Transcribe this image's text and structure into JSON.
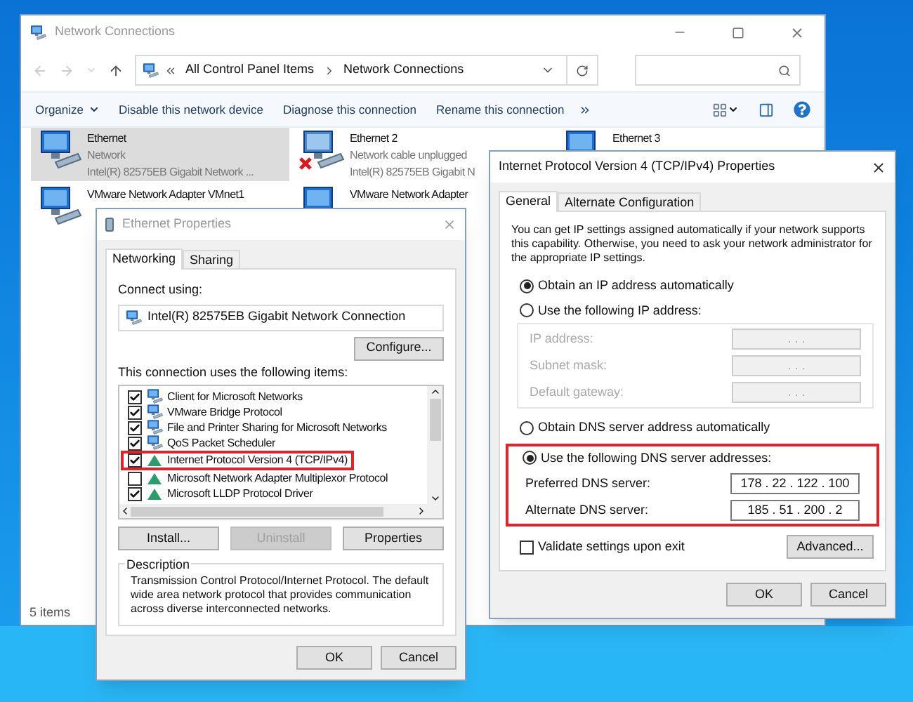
{
  "window": {
    "title": "Network Connections",
    "breadcrumb": [
      "All Control Panel Items",
      "Network Connections"
    ]
  },
  "toolbar": [
    {
      "label": "Organize",
      "dropdown": true
    },
    {
      "label": "Disable this network device",
      "dropdown": false
    },
    {
      "label": "Diagnose this connection",
      "dropdown": false
    },
    {
      "label": "Rename this connection",
      "dropdown": false
    }
  ],
  "connections": [
    {
      "name": "Ethernet",
      "status": "Network",
      "adapter": "Intel(R) 82575EB Gigabit Network ...",
      "selected": true,
      "disconnected": false
    },
    {
      "name": "Ethernet 2",
      "status": "Network cable unplugged",
      "adapter": "Intel(R) 82575EB Gigabit N",
      "selected": false,
      "disconnected": true
    },
    {
      "name": "Ethernet 3",
      "selected": false,
      "disconnected": false
    },
    {
      "name": "VMware Network Adapter VMnet1",
      "selected": false,
      "disconnected": false
    },
    {
      "name": "VMware Network Adapter",
      "selected": false,
      "disconnected": false
    }
  ],
  "status_bar": "5 items",
  "ethernet_properties": {
    "title": "Ethernet Properties",
    "tabs": [
      {
        "label": "Networking",
        "selected": true
      },
      {
        "label": "Sharing",
        "selected": false
      }
    ],
    "connect_using_label": "Connect using:",
    "adapter": "Intel(R) 82575EB Gigabit Network Connection",
    "configure_button": "Configure...",
    "items_label": "This connection uses the following items:",
    "items": [
      {
        "label": "Client for Microsoft Networks",
        "kind": "service",
        "checked": true,
        "highlighted": false
      },
      {
        "label": "VMware Bridge Protocol",
        "kind": "service",
        "checked": true,
        "highlighted": false
      },
      {
        "label": "File and Printer Sharing for Microsoft Networks",
        "kind": "service",
        "checked": true,
        "highlighted": false
      },
      {
        "label": "QoS Packet Scheduler",
        "kind": "service",
        "checked": true,
        "highlighted": false
      },
      {
        "label": "Internet Protocol Version 4 (TCP/IPv4)",
        "kind": "protocol",
        "checked": true,
        "highlighted": true
      },
      {
        "label": "Microsoft Network Adapter Multiplexor Protocol",
        "kind": "protocol",
        "checked": false,
        "highlighted": false
      },
      {
        "label": "Microsoft LLDP Protocol Driver",
        "kind": "protocol",
        "checked": true,
        "highlighted": false
      }
    ],
    "buttons": [
      {
        "label": "Install...",
        "disabled": false
      },
      {
        "label": "Uninstall",
        "disabled": true
      },
      {
        "label": "Properties",
        "disabled": false
      }
    ],
    "description_label": "Description",
    "description": "Transmission Control Protocol/Internet Protocol. The default wide area network protocol that provides communication across diverse interconnected networks.",
    "dialog_buttons": [
      "OK",
      "Cancel"
    ]
  },
  "ipv4_properties": {
    "title": "Internet Protocol Version 4 (TCP/IPv4) Properties",
    "tabs": [
      {
        "label": "General",
        "selected": true
      },
      {
        "label": "Alternate Configuration",
        "selected": false
      }
    ],
    "intro": "You can get IP settings assigned automatically if your network supports this capability. Otherwise, you need to ask your network administrator for the appropriate IP settings.",
    "ip_options": [
      {
        "label": "Obtain an IP address automatically",
        "selected": true
      },
      {
        "label": "Use the following IP address:",
        "selected": false
      }
    ],
    "ip_fields": [
      {
        "label": "IP address:",
        "value": ". . .",
        "disabled": true
      },
      {
        "label": "Subnet mask:",
        "value": ". . .",
        "disabled": true
      },
      {
        "label": "Default gateway:",
        "value": ". . .",
        "disabled": true
      }
    ],
    "dns_options": [
      {
        "label": "Obtain DNS server address automatically",
        "selected": false
      },
      {
        "label": "Use the following DNS server addresses:",
        "selected": true
      }
    ],
    "dns_highlighted": true,
    "dns_fields": [
      {
        "label": "Preferred DNS server:",
        "value": "178 . 22 . 122 . 100",
        "disabled": false
      },
      {
        "label": "Alternate DNS server:",
        "value": "185 . 51 . 200 . 2",
        "disabled": false
      }
    ],
    "validate": {
      "label": "Validate settings upon exit",
      "checked": false
    },
    "advanced_button": "Advanced...",
    "dialog_buttons": [
      "OK",
      "Cancel"
    ]
  }
}
